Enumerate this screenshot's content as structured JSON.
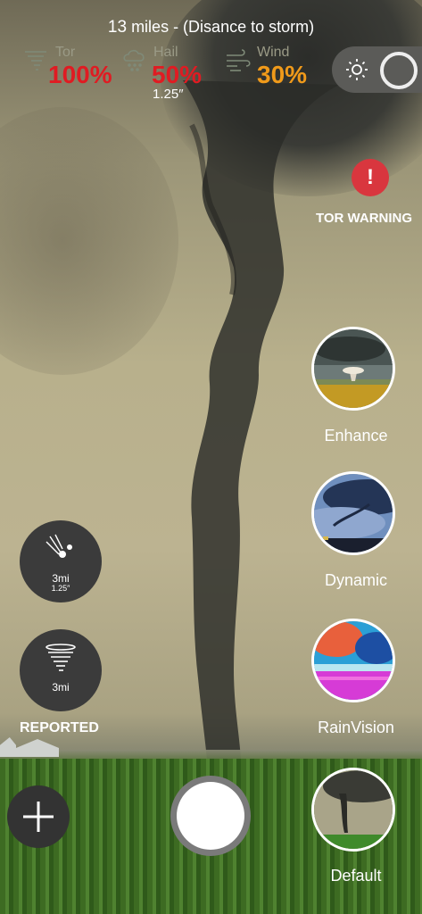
{
  "header": {
    "distance_value": "13",
    "distance_text": "miles - (Disance to storm)"
  },
  "metrics": [
    {
      "label": "Tor",
      "value": "100%",
      "color": "#e01b22",
      "icon": "tornado-icon"
    },
    {
      "label": "Hail",
      "value": "50%",
      "color": "#e01b22",
      "icon": "hail-icon",
      "sub": "1.25″"
    },
    {
      "label": "Wind",
      "value": "30%",
      "color": "#f09a1a",
      "icon": "wind-icon"
    }
  ],
  "toggle": {
    "icon": "sun-icon",
    "state": "off"
  },
  "warning": {
    "badge": "!",
    "label": "TOR WARNING",
    "color": "#d9363e"
  },
  "modes": [
    {
      "label": "Enhance"
    },
    {
      "label": "Dynamic"
    },
    {
      "label": "RainVision"
    },
    {
      "label": "Default"
    }
  ],
  "reports": {
    "hail": {
      "distance": "3mi",
      "size": "1.25″"
    },
    "tornado": {
      "distance": "3mi"
    },
    "label": "REPORTED"
  },
  "controls": {
    "add_icon": "plus-icon",
    "capture": "shutter"
  }
}
